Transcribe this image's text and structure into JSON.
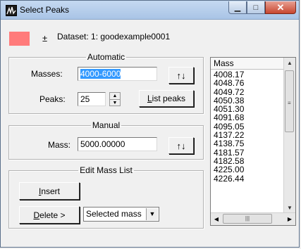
{
  "window": {
    "title": "Select Peaks"
  },
  "header": {
    "plus_minus": "±",
    "dataset_label": "Dataset:  1: goodexample0001"
  },
  "automatic": {
    "legend": "Automatic",
    "masses_label": "Masses:",
    "masses_value": "4000-6000",
    "peaks_label": "Peaks:",
    "peaks_value": "25",
    "sort_label": "↑↓",
    "list_peaks_mnemonic": "L",
    "list_peaks_rest": "ist peaks"
  },
  "manual": {
    "legend": "Manual",
    "mass_label": "Mass:",
    "mass_value": "5000.00000",
    "sort_label": "↑↓"
  },
  "edit_mass_list": {
    "legend": "Edit Mass List",
    "insert_mnemonic": "I",
    "insert_rest": "nsert",
    "delete_mnemonic": "D",
    "delete_rest": "elete >",
    "delete_mode_selected": "Selected mass"
  },
  "mass_list": {
    "header": "Mass",
    "items": [
      "4008.17",
      "4048.76",
      "4049.72",
      "4050.38",
      "4051.30",
      "4091.68",
      "4095.05",
      "4137.22",
      "4138.75",
      "4181.57",
      "4182.58",
      "4225.00",
      "4226.44"
    ]
  },
  "icons": {
    "minimize": "minimize-icon",
    "maximize": "maximize-icon",
    "close": "close-icon",
    "scroll_up": "chevron-up-icon",
    "scroll_down": "chevron-down-icon",
    "scroll_left": "chevron-left-icon",
    "scroll_right": "chevron-right-icon"
  },
  "colors": {
    "dataset_swatch": "#ff7b7b",
    "selection": "#3399ff"
  }
}
